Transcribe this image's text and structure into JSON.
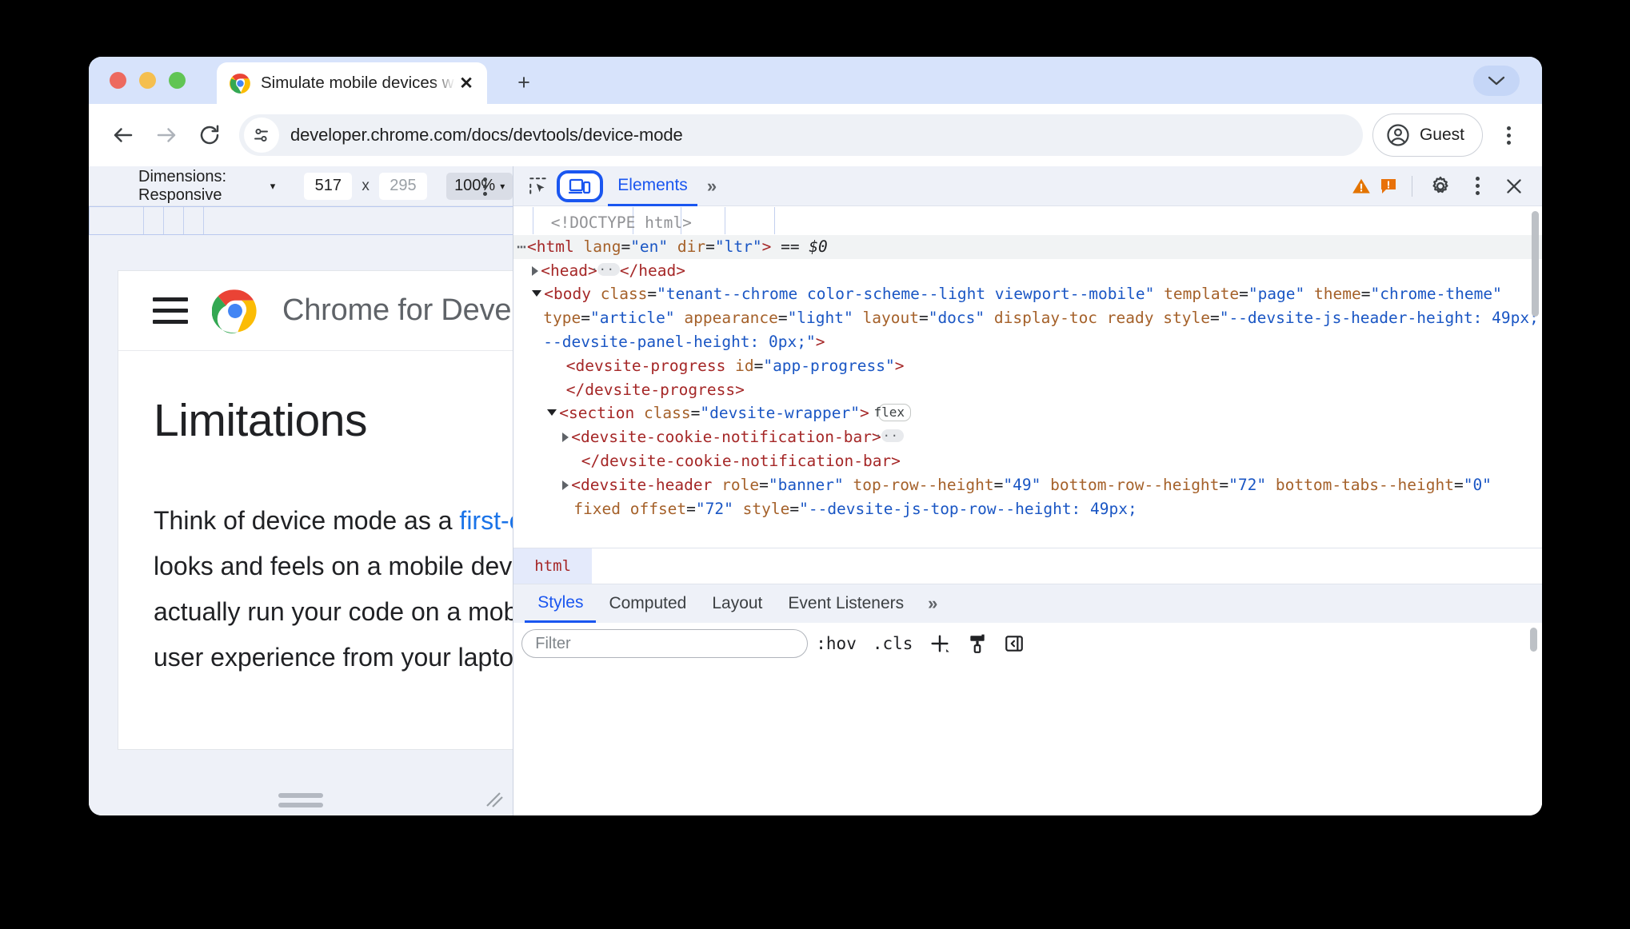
{
  "browser": {
    "tab": {
      "title": "Simulate mobile devices with",
      "favicon": "chrome-logo-icon",
      "close_icon": "close-icon"
    },
    "new_tab_label": "+",
    "tabstrip_chevron_icon": "chevron-down-icon",
    "nav": {
      "back_icon": "back-arrow-icon",
      "forward_icon": "forward-arrow-icon",
      "reload_icon": "reload-icon"
    },
    "omnibox": {
      "site_settings_icon": "tune-icon",
      "url": "developer.chrome.com/docs/devtools/device-mode"
    },
    "profile": {
      "avatar_icon": "account-circle-icon",
      "label": "Guest"
    },
    "menu_icon": "kebab-menu-icon"
  },
  "device_toolbar": {
    "dimensions_label": "Dimensions: Responsive",
    "dimensions_caret": "▾",
    "width_value": "517",
    "separator": "x",
    "height_value": "295",
    "zoom_value": "100%",
    "zoom_caret": "▾",
    "more_icon": "kebab-menu-icon"
  },
  "viewport": {
    "site": {
      "menu_icon": "hamburger-menu-icon",
      "logo_icon": "chrome-logo-icon",
      "title": "Chrome for Developers"
    },
    "doc": {
      "heading": "Limitations",
      "paragraph_part1": "Think of device mode as a ",
      "paragraph_link": "first-order approximation",
      "paragraph_part2": " of how your page looks and feels on a mobile device. With device mode you don't actually run your code on a mobile device. You simulate the mobile user experience from your laptop or desktop."
    },
    "handle_right": "resize-handle-right",
    "handle_bottom": "resize-handle-bottom",
    "handle_corner": "resize-handle-corner"
  },
  "devtools": {
    "toolbar": {
      "inspect_icon": "inspect-element-icon",
      "device_toggle_icon": "device-toolbar-icon",
      "device_toggle_active": true,
      "active_tab": "Elements",
      "more_tabs": "»",
      "warning_icon": "warning-triangle-icon",
      "error_icon": "error-badge-icon",
      "settings_icon": "gear-icon",
      "menu_icon": "kebab-menu-icon",
      "close_icon": "close-icon"
    },
    "dom_tree": [
      {
        "indent": 1,
        "arrow": "none",
        "prefix": "",
        "segments": [
          {
            "t": "comment",
            "v": "<!DOCTYPE html>"
          }
        ]
      },
      {
        "indent": 0,
        "arrow": "dots",
        "selected": true,
        "segments": [
          {
            "t": "tag",
            "v": "<html"
          },
          {
            "t": "sp",
            "v": " "
          },
          {
            "t": "attrname",
            "v": "lang"
          },
          {
            "t": "punc",
            "v": "="
          },
          {
            "t": "attrval",
            "v": "\"en\""
          },
          {
            "t": "sp",
            "v": " "
          },
          {
            "t": "attrname",
            "v": "dir"
          },
          {
            "t": "punc",
            "v": "="
          },
          {
            "t": "attrval",
            "v": "\"ltr\""
          },
          {
            "t": "tag",
            "v": ">"
          },
          {
            "t": "sp",
            "v": " "
          },
          {
            "t": "eqref",
            "v": "== $0"
          }
        ]
      },
      {
        "indent": 1,
        "arrow": "right",
        "segments": [
          {
            "t": "tag",
            "v": "<head>"
          },
          {
            "t": "pill",
            "v": "…"
          },
          {
            "t": "tag",
            "v": "</head>"
          }
        ]
      },
      {
        "indent": 1,
        "arrow": "down",
        "segments": [
          {
            "t": "tag",
            "v": "<body"
          },
          {
            "t": "sp",
            "v": " "
          },
          {
            "t": "attrname",
            "v": "class"
          },
          {
            "t": "punc",
            "v": "="
          },
          {
            "t": "attrval",
            "v": "\"tenant--chrome color-scheme--light viewport--mobile\""
          },
          {
            "t": "sp",
            "v": " "
          },
          {
            "t": "attrname",
            "v": "template"
          },
          {
            "t": "punc",
            "v": "="
          },
          {
            "t": "attrval",
            "v": "\"page\""
          },
          {
            "t": "sp",
            "v": " "
          },
          {
            "t": "attrname",
            "v": "theme"
          },
          {
            "t": "punc",
            "v": "="
          },
          {
            "t": "attrval",
            "v": "\"chrome-theme\""
          },
          {
            "t": "sp",
            "v": " "
          },
          {
            "t": "attrname",
            "v": "type"
          },
          {
            "t": "punc",
            "v": "="
          },
          {
            "t": "attrval",
            "v": "\"article\""
          },
          {
            "t": "sp",
            "v": " "
          },
          {
            "t": "attrname",
            "v": "appearance"
          },
          {
            "t": "punc",
            "v": "="
          },
          {
            "t": "attrval",
            "v": "\"light\""
          },
          {
            "t": "sp",
            "v": " "
          },
          {
            "t": "attrname",
            "v": "layout"
          },
          {
            "t": "punc",
            "v": "="
          },
          {
            "t": "attrval",
            "v": "\"docs\""
          },
          {
            "t": "sp",
            "v": " "
          },
          {
            "t": "attrname",
            "v": "display-toc"
          },
          {
            "t": "sp",
            "v": " "
          },
          {
            "t": "attrname",
            "v": "ready"
          },
          {
            "t": "sp",
            "v": " "
          },
          {
            "t": "attrname",
            "v": "style"
          },
          {
            "t": "punc",
            "v": "="
          },
          {
            "t": "attrval",
            "v": "\"--devsite-js-header-height: 49px; --devsite-panel-height: 0px;\""
          },
          {
            "t": "tag",
            "v": ">"
          }
        ]
      },
      {
        "indent": 2,
        "arrow": "none",
        "segments": [
          {
            "t": "tag",
            "v": "<devsite-progress"
          },
          {
            "t": "sp",
            "v": " "
          },
          {
            "t": "attrname",
            "v": "id"
          },
          {
            "t": "punc",
            "v": "="
          },
          {
            "t": "attrval",
            "v": "\"app-progress\""
          },
          {
            "t": "tag",
            "v": ">"
          }
        ]
      },
      {
        "indent": 2,
        "arrow": "none",
        "segments": [
          {
            "t": "tag",
            "v": "</devsite-progress>"
          }
        ]
      },
      {
        "indent": 2,
        "arrow": "down",
        "segments": [
          {
            "t": "tag",
            "v": "<section"
          },
          {
            "t": "sp",
            "v": " "
          },
          {
            "t": "attrname",
            "v": "class"
          },
          {
            "t": "punc",
            "v": "="
          },
          {
            "t": "attrval",
            "v": "\"devsite-wrapper\""
          },
          {
            "t": "tag",
            "v": ">"
          },
          {
            "t": "sp",
            "v": " "
          },
          {
            "t": "flex",
            "v": "flex"
          }
        ]
      },
      {
        "indent": 3,
        "arrow": "right",
        "segments": [
          {
            "t": "tag",
            "v": "<devsite-cookie-notification-bar>"
          },
          {
            "t": "pill",
            "v": "…"
          }
        ]
      },
      {
        "indent": 3,
        "arrow": "none",
        "segments": [
          {
            "t": "tag",
            "v": "</devsite-cookie-notification-bar>"
          }
        ]
      },
      {
        "indent": 3,
        "arrow": "right",
        "segments": [
          {
            "t": "tag",
            "v": "<devsite-header"
          },
          {
            "t": "sp",
            "v": " "
          },
          {
            "t": "attrname",
            "v": "role"
          },
          {
            "t": "punc",
            "v": "="
          },
          {
            "t": "attrval",
            "v": "\"banner\""
          },
          {
            "t": "sp",
            "v": " "
          },
          {
            "t": "attrname",
            "v": "top-row--height"
          },
          {
            "t": "punc",
            "v": "="
          },
          {
            "t": "attrval",
            "v": "\"49\""
          },
          {
            "t": "sp",
            "v": " "
          },
          {
            "t": "attrname",
            "v": "bottom-row--height"
          },
          {
            "t": "punc",
            "v": "="
          },
          {
            "t": "attrval",
            "v": "\"72\""
          },
          {
            "t": "sp",
            "v": " "
          },
          {
            "t": "attrname",
            "v": "bottom-tabs--height"
          },
          {
            "t": "punc",
            "v": "="
          },
          {
            "t": "attrval",
            "v": "\"0\""
          },
          {
            "t": "sp",
            "v": " "
          },
          {
            "t": "attrname",
            "v": "fixed"
          },
          {
            "t": "sp",
            "v": " "
          },
          {
            "t": "attrname",
            "v": "offset"
          },
          {
            "t": "punc",
            "v": "="
          },
          {
            "t": "attrval",
            "v": "\"72\""
          },
          {
            "t": "sp",
            "v": " "
          },
          {
            "t": "attrname",
            "v": "style"
          },
          {
            "t": "punc",
            "v": "="
          },
          {
            "t": "attrval",
            "v": "\"--devsite-js-top-row--height: 49px;"
          }
        ]
      }
    ],
    "breadcrumb": [
      "html"
    ],
    "sidebar_tabs": [
      {
        "label": "Styles",
        "active": true
      },
      {
        "label": "Computed",
        "active": false
      },
      {
        "label": "Layout",
        "active": false
      },
      {
        "label": "Event Listeners",
        "active": false
      }
    ],
    "sidebar_more": "»",
    "styles": {
      "filter_placeholder": "Filter",
      "filter_value": "",
      "hov_label": ":hov",
      "cls_label": ".cls",
      "new_rule_icon": "plus-icon",
      "style_element_icon": "paintbrush-icon",
      "toggle_sidebar_icon": "panel-toggle-icon"
    }
  },
  "colors": {
    "accent_blue": "#1a56f0",
    "link_blue": "#1a73e8",
    "tabstrip_bg": "#d7e3fb",
    "devtools_bg": "#eef1f8",
    "warning_orange": "#e37400",
    "error_orange": "#e8710a"
  }
}
